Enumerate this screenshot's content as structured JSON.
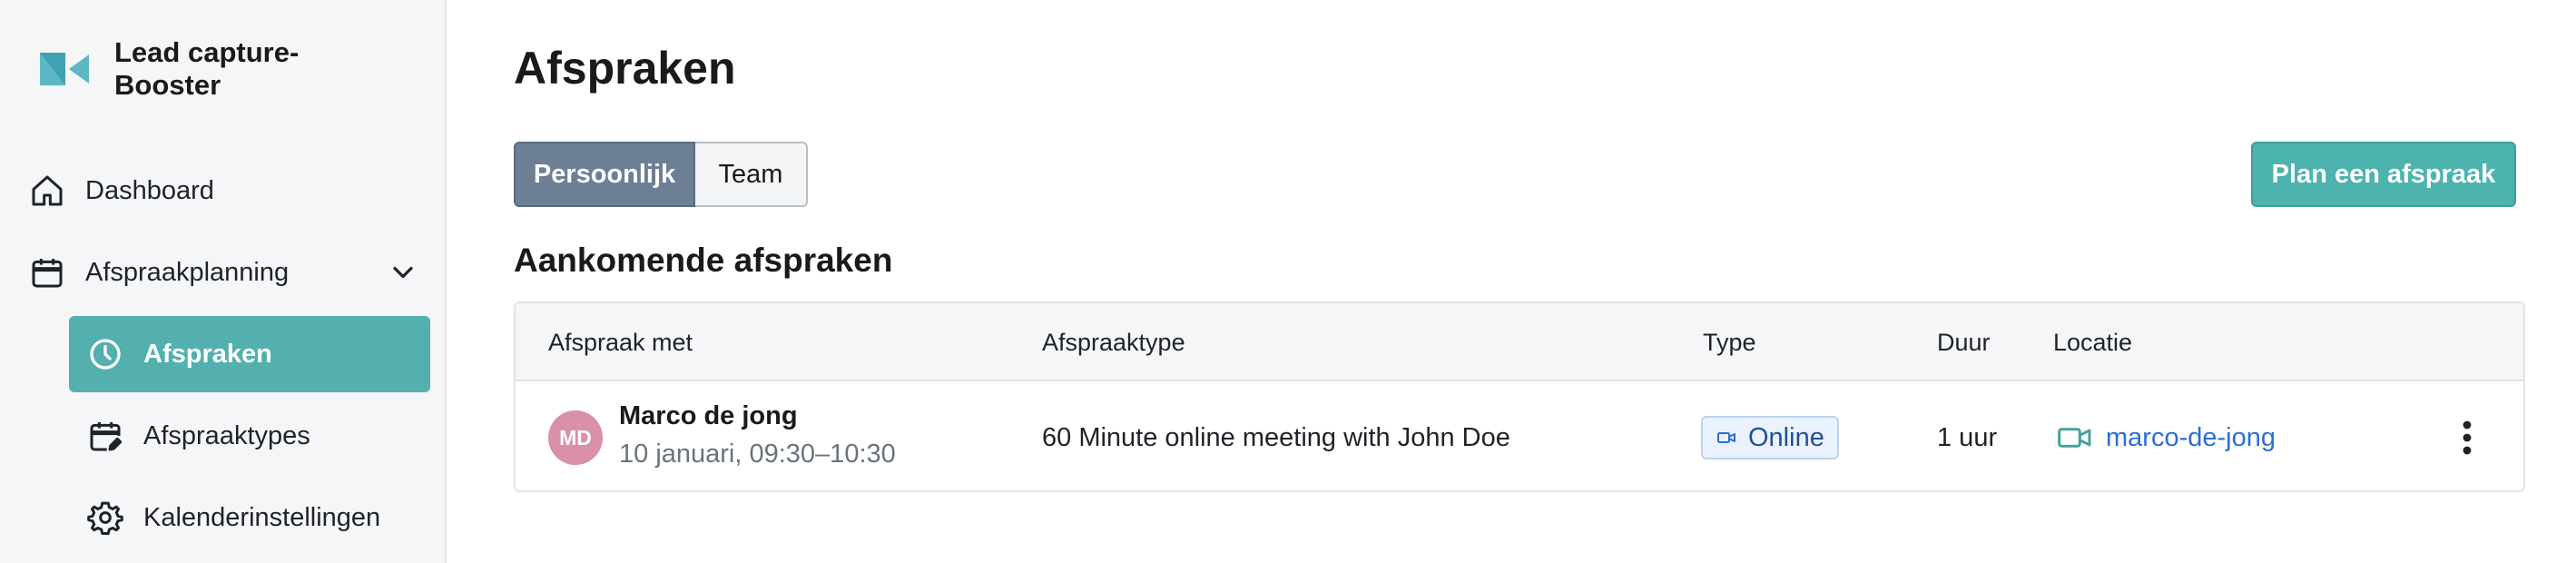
{
  "brand": {
    "name_line1": "Lead capture-",
    "name_line2": "Booster",
    "logo_icon": "video-camera-logo-icon",
    "accent_color": "#53b0ae"
  },
  "sidebar": {
    "items": [
      {
        "label": "Dashboard",
        "icon": "home-icon"
      },
      {
        "label": "Afspraakplanning",
        "icon": "calendar-icon",
        "expanded": true
      }
    ],
    "subitems": [
      {
        "label": "Afspraken",
        "icon": "clock-icon",
        "active": true
      },
      {
        "label": "Afspraaktypes",
        "icon": "calendar-edit-icon"
      },
      {
        "label": "Kalenderinstellingen",
        "icon": "gear-icon"
      }
    ]
  },
  "main": {
    "title": "Afspraken",
    "segmented": {
      "options": [
        "Persoonlijk",
        "Team"
      ],
      "selected": "Persoonlijk"
    },
    "primary_button": "Plan een afspraak",
    "section_title": "Aankomende afspraken",
    "table": {
      "columns": [
        "Afspraak met",
        "Afspraaktype",
        "Type",
        "Duur",
        "Locatie"
      ],
      "rows": [
        {
          "avatar_initials": "MD",
          "name": "Marco de jong",
          "datetime": "10 januari, 09:30–10:30",
          "appointment_type": "60 Minute online meeting with John Doe",
          "type_badge": "Online",
          "type_icon": "video-icon",
          "duration": "1 uur",
          "location": "marco-de-jong",
          "location_icon": "video-camera-icon",
          "menu_icon": "more-vertical-icon"
        }
      ]
    }
  }
}
